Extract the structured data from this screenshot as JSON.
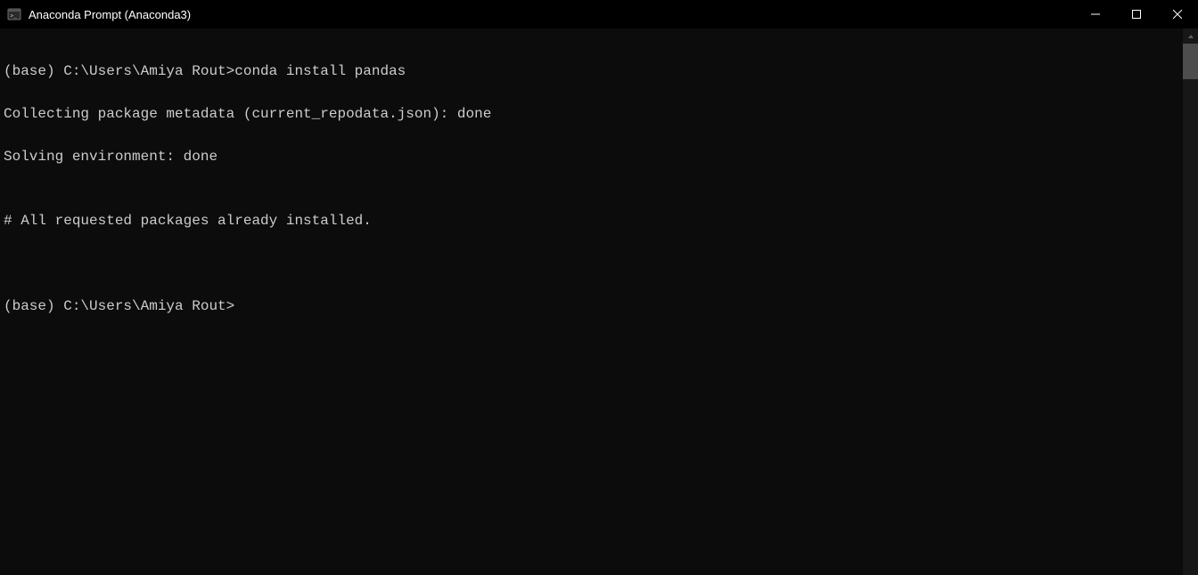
{
  "window": {
    "title": "Anaconda Prompt (Anaconda3)"
  },
  "terminal": {
    "lines": [
      "(base) C:\\Users\\Amiya Rout>conda install pandas",
      "Collecting package metadata (current_repodata.json): done",
      "Solving environment: done",
      "",
      "# All requested packages already installed.",
      "",
      "",
      "(base) C:\\Users\\Amiya Rout>"
    ]
  }
}
